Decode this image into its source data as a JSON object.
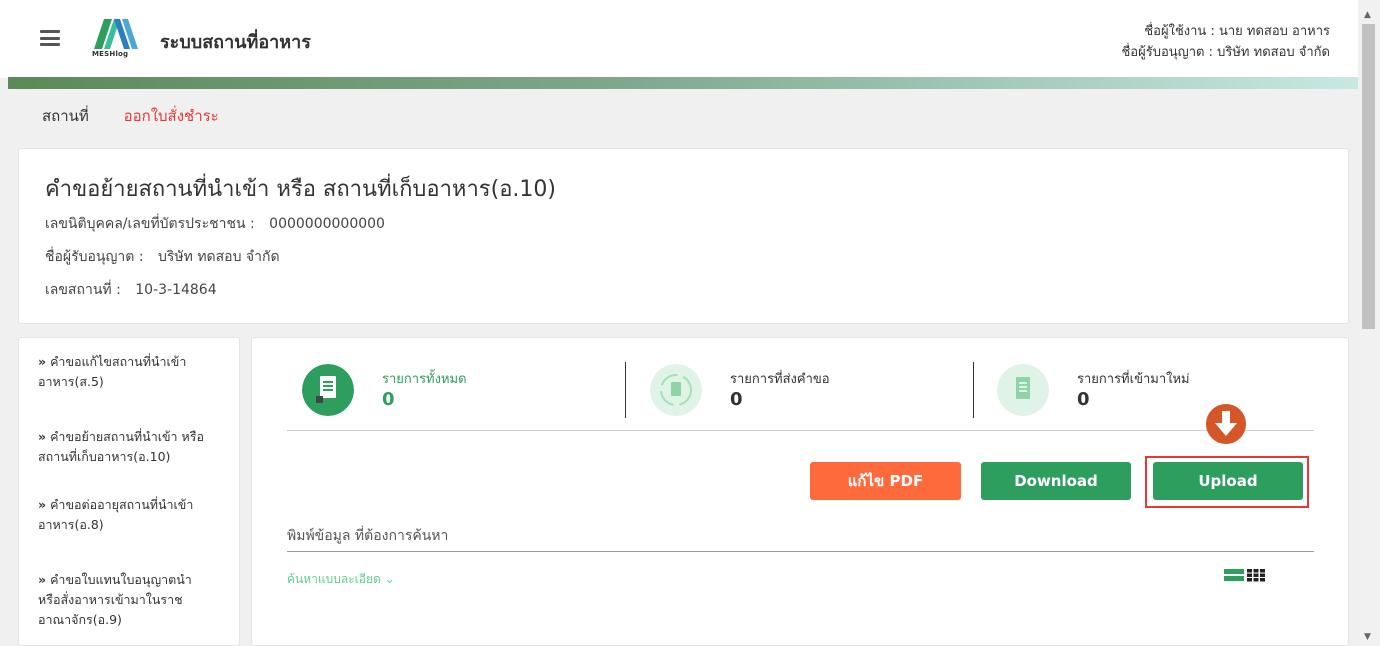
{
  "header": {
    "app_title": "ระบบสถานที่อาหาร",
    "logo_text": "MESHlog",
    "user_line": "ชื่อผู้ใช้งาน : นาย ทดสอบ อาหาร",
    "licensee_line": "ชื่อผู้รับอนุญาต : บริษัท ทดสอบ จำกัด"
  },
  "subnav": {
    "items": [
      "สถานที่",
      "ออกใบสั่งชำระ"
    ]
  },
  "info": {
    "title": "คำขอย้ายสถานที่นำเข้า หรือ สถานที่เก็บอาหาร(อ.10)",
    "id_label": "เลขนิติบุคคล/เลขที่บัตรประชาชน :",
    "id_value": "0000000000000",
    "licensee_label": "ชื่อผู้รับอนุญาต :",
    "licensee_value": "บริษัท ทดสอบ จำกัด",
    "place_label": "เลขสถานที่ :",
    "place_value": "10-3-14864"
  },
  "sidebar": {
    "items": [
      {
        "line1": "คำขอแก้ไขสถานที่นำเข้า",
        "line2": "อาหาร(ส.5)"
      },
      {
        "line1": "คำขอย้ายสถานที่นำเข้า หรือ",
        "line2": "สถานที่เก็บอาหาร(อ.10)"
      },
      {
        "line1": "คำขอต่ออายุสถานที่นำเข้า",
        "line2": "อาหาร(อ.8)"
      },
      {
        "line1": "คำขอใบแทนใบอนุญาตนำ",
        "line2": "หรือสั่งอาหารเข้ามาในราช",
        "line3": "อาณาจักร(อ.9)"
      }
    ]
  },
  "stats": [
    {
      "label": "รายการทั้งหมด",
      "value": "0",
      "icon": "document-icon"
    },
    {
      "label": "รายการที่ส่งคำขอ",
      "value": "0",
      "icon": "refresh-document-icon"
    },
    {
      "label": "รายการที่เข้ามาใหม่",
      "value": "0",
      "icon": "new-document-icon"
    }
  ],
  "buttons": {
    "edit_pdf": "แก้ไข PDF",
    "download": "Download",
    "upload": "Upload"
  },
  "search": {
    "label": "พิมพ์ข้อมูล ที่ต้องการค้นหา",
    "advanced": "ค้นหาแบบละเอียด"
  },
  "colors": {
    "brand_green": "#2e9e5e",
    "accent_orange": "#ff6a3d",
    "highlight_red": "#e53935",
    "link_green": "#5fcf8e"
  }
}
